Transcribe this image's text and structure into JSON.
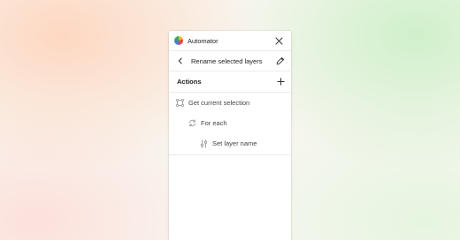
{
  "header": {
    "app_title": "Automator",
    "logo_icon": "automator-logo",
    "close_icon": "close-icon"
  },
  "nav": {
    "back_icon": "chevron-left-icon",
    "title": "Rename selected layers",
    "edit_icon": "pencil-icon"
  },
  "section": {
    "title": "Actions",
    "add_icon": "plus-icon"
  },
  "actions": [
    {
      "label": "Get current selection",
      "icon": "selection-icon",
      "level": 0
    },
    {
      "label": "For each",
      "icon": "loop-icon",
      "level": 1
    },
    {
      "label": "Set layer name",
      "icon": "sliders-icon",
      "level": 2
    }
  ],
  "colors": {
    "panel_bg": "#ffffff",
    "divider": "#ebebeb",
    "text": "#1f1f1f",
    "muted_icon": "#9a9a9a"
  }
}
